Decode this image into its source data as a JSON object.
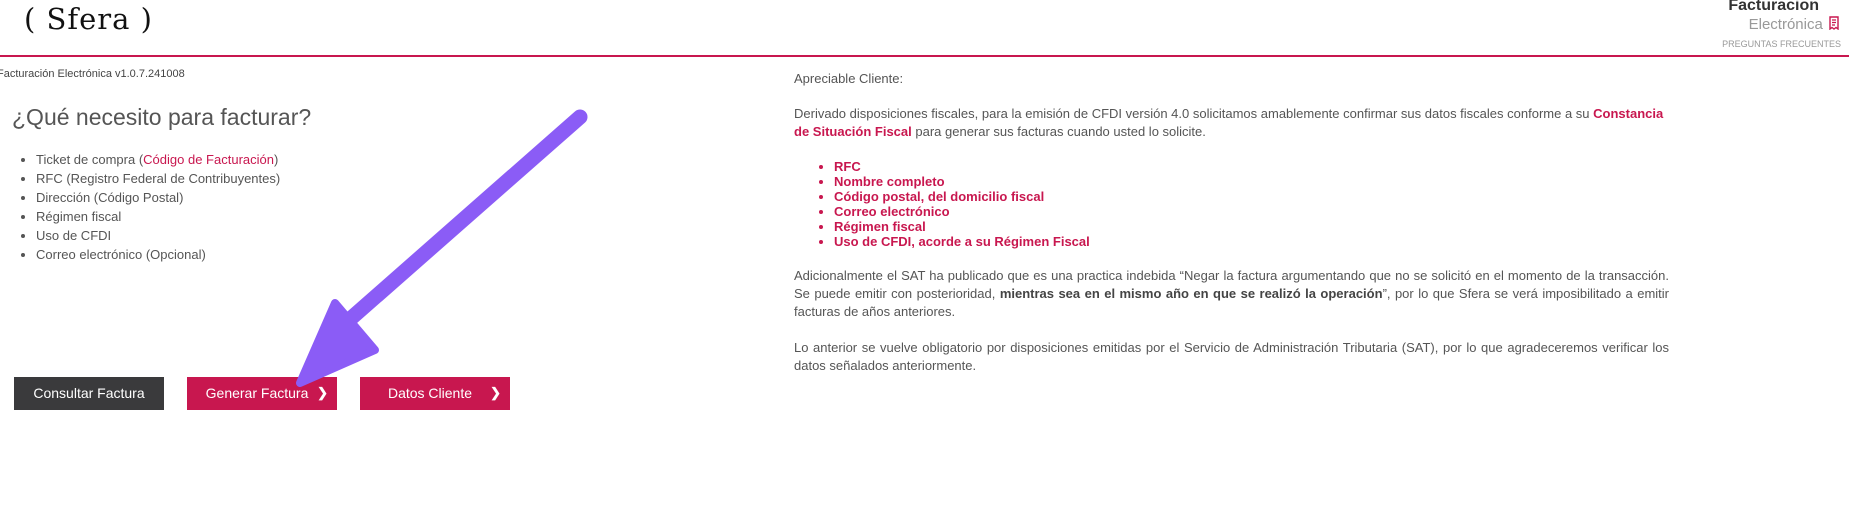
{
  "header": {
    "logo": "( Sfera )",
    "brand_title": "Facturacion",
    "brand_subtitle": "Electrónica",
    "faq_link": "PREGUNTAS FRECUENTES",
    "accent_color": "#c8174f"
  },
  "left": {
    "version": "Facturación Electrónica v1.0.7.241008",
    "title": "¿Qué necesito para facturar?",
    "requirements": [
      {
        "prefix": "Ticket de compra (",
        "highlight": "Código de Facturación",
        "suffix": ")"
      },
      {
        "text": "RFC (Registro Federal de Contribuyentes)"
      },
      {
        "text": "Dirección (Código Postal)"
      },
      {
        "text": "Régimen fiscal"
      },
      {
        "text": "Uso de CFDI"
      },
      {
        "text": "Correo electrónico (Opcional)"
      }
    ],
    "buttons": {
      "consultar": "Consultar Factura",
      "generar": "Generar Factura",
      "datos": "Datos Cliente",
      "chevron_icon": "chevron-right-icon"
    }
  },
  "notice": {
    "greeting": "Apreciable Cliente:",
    "p1_before": "Derivado disposiciones fiscales, para la emisión de CFDI versión 4.0 solicitamos amablemente confirmar sus datos fiscales conforme a su ",
    "p1_link": "Constancia de Situación Fiscal",
    "p1_after": " para generar sus facturas cuando usted lo solicite.",
    "items": [
      "RFC",
      "Nombre completo",
      "Código postal, del domicilio fiscal",
      "Correo electrónico",
      "Régimen fiscal",
      "Uso de CFDI, acorde a su Régimen Fiscal"
    ],
    "p2_before": "Adicionalmente el SAT ha publicado que es una practica indebida “Negar la factura argumentando que no se solicitó en el momento de la transacción. Se puede emitir con posterioridad, ",
    "p2_bold": "mientras sea en el mismo año en que se realizó la operación",
    "p2_after": "”, por lo que Sfera se verá imposibilitado a emitir facturas de años anteriores.",
    "p3": "Lo anterior se vuelve obligatorio por disposiciones emitidas por el Servicio de Administración Tributaria (SAT), por lo que agradeceremos verificar los datos señalados anteriormente."
  },
  "annotation": {
    "arrow_color": "#8b5cf6"
  }
}
